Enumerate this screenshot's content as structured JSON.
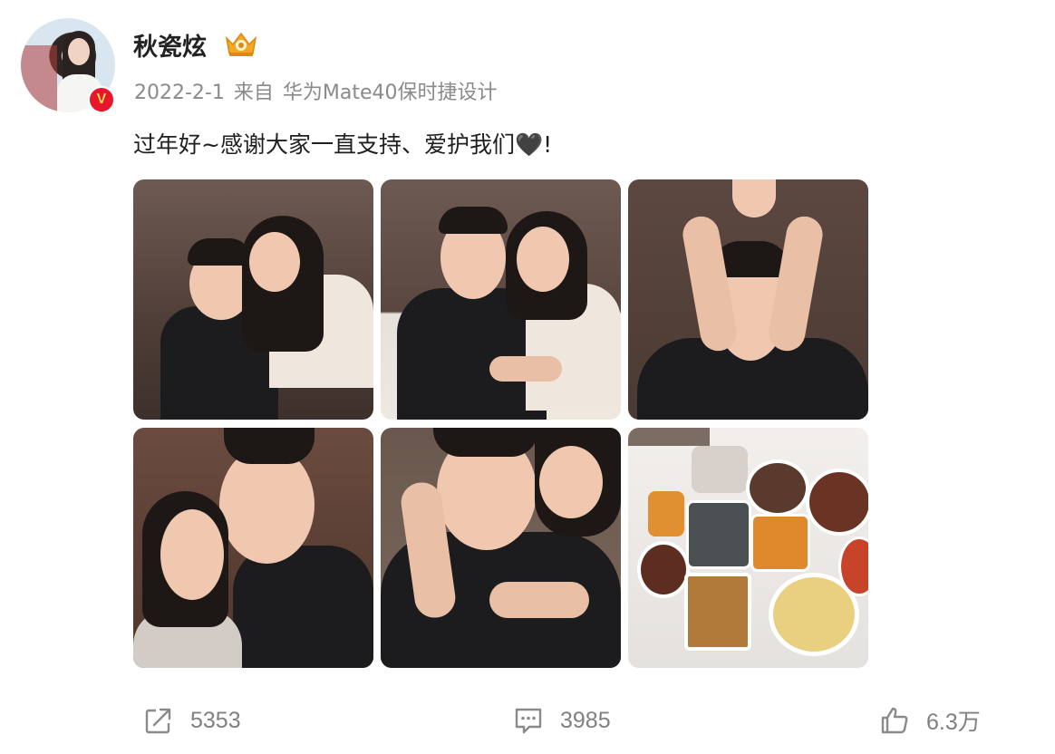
{
  "post": {
    "username": "秋瓷炫",
    "date": "2022-2-1",
    "source_prefix": "来自",
    "source_device": "华为Mate40保时捷设计",
    "text": "过年好~感谢大家一直支持、爱护我们🖤!"
  },
  "photos": [
    {
      "id": 1
    },
    {
      "id": 2
    },
    {
      "id": 3
    },
    {
      "id": 4
    },
    {
      "id": 5
    },
    {
      "id": 6
    }
  ],
  "actions": {
    "repost_count": "5353",
    "comment_count": "3985",
    "like_count": "6.3万"
  },
  "icons": {
    "verified": "verified-v-badge",
    "crown": "crown-icon",
    "repost": "repost-icon",
    "comment": "comment-icon",
    "like": "thumbs-up-icon"
  },
  "colors": {
    "verified_badge": "#e6162d",
    "crown": "#f5a623",
    "meta_text": "#8a8a8a",
    "action_text": "#808080"
  }
}
